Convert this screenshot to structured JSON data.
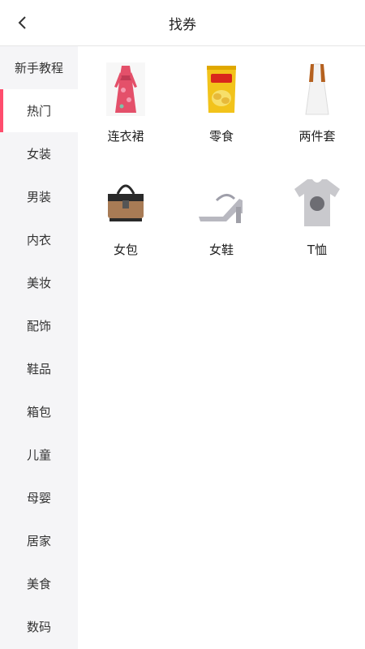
{
  "header": {
    "title": "找券",
    "back_icon": "chevron-left-icon"
  },
  "sidebar": {
    "active_index": 1,
    "items": [
      {
        "label": "新手教程"
      },
      {
        "label": "热门"
      },
      {
        "label": "女装"
      },
      {
        "label": "男装"
      },
      {
        "label": "内衣"
      },
      {
        "label": "美妆"
      },
      {
        "label": "配饰"
      },
      {
        "label": "鞋品"
      },
      {
        "label": "箱包"
      },
      {
        "label": "儿童"
      },
      {
        "label": "母婴"
      },
      {
        "label": "居家"
      },
      {
        "label": "美食"
      },
      {
        "label": "数码"
      }
    ]
  },
  "categories": [
    {
      "label": "连衣裙",
      "icon": "dress-icon"
    },
    {
      "label": "零食",
      "icon": "snack-bag-icon"
    },
    {
      "label": "两件套",
      "icon": "two-piece-icon"
    },
    {
      "label": "女包",
      "icon": "handbag-icon"
    },
    {
      "label": "女鞋",
      "icon": "heel-shoe-icon"
    },
    {
      "label": "T恤",
      "icon": "tshirt-icon"
    }
  ],
  "colors": {
    "accent": "#ff4d6d",
    "sidebar_bg": "#f5f5f7"
  }
}
